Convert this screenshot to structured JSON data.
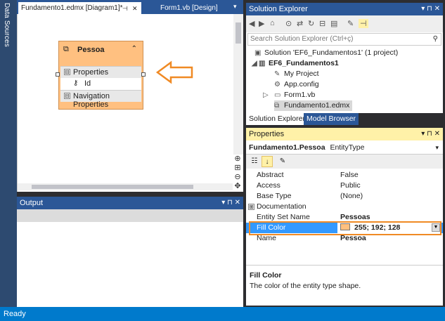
{
  "left_dock": {
    "label": "Data Sources"
  },
  "doc_tabs": [
    {
      "label": "Fundamento1.edmx [Diagram1]*",
      "active": true,
      "pin_icon": "pin-icon",
      "close_icon": "close-icon"
    },
    {
      "label": "Form1.vb [Design]",
      "active": false
    }
  ],
  "entity": {
    "icon": "entity-icon",
    "name": "Pessoa",
    "collapse_icon": "chevron-up-icon",
    "sections": [
      {
        "label": "Properties",
        "expander": "⊟"
      },
      {
        "label": "Navigation Properties",
        "expander": "⊟"
      }
    ],
    "properties": [
      {
        "icon": "key-icon",
        "label": "Id"
      }
    ],
    "fill_color": "#ffc080"
  },
  "annotation_arrow": {
    "icon": "arrow-left-icon",
    "color": "#f08a24"
  },
  "output_panel": {
    "title": "Output",
    "controls": "▾ ⊓ ✕"
  },
  "solution_explorer": {
    "title": "Solution Explorer",
    "controls": "▾ ⊓ ✕",
    "search_placeholder": "Search Solution Explorer (Ctrl+ç)",
    "tree": [
      {
        "label": "Solution 'EF6_Fundamentos1' (1 project)",
        "icon": "solution-icon",
        "level": 0,
        "bold": false
      },
      {
        "label": "EF6_Fundamentos1",
        "icon": "vb-project-icon",
        "level": 1,
        "bold": true,
        "expander": "◢"
      },
      {
        "label": "My Project",
        "icon": "wrench-icon",
        "level": 2
      },
      {
        "label": "App.config",
        "icon": "config-icon",
        "level": 2
      },
      {
        "label": "Form1.vb",
        "icon": "form-icon",
        "level": 2,
        "expander": "▷"
      },
      {
        "label": "Fundamento1.edmx",
        "icon": "edmx-icon",
        "level": 2,
        "selected": true
      }
    ],
    "bottom_tabs": [
      {
        "label": "Solution Explorer",
        "active": true
      },
      {
        "label": "Model Browser",
        "active": false
      }
    ]
  },
  "properties": {
    "title": "Properties",
    "controls": "▾ ⊓ ✕",
    "object_name": "Fundamento1.Pessoa",
    "object_type": "EntityType",
    "rows": [
      {
        "name": "Abstract",
        "value": "False"
      },
      {
        "name": "Access",
        "value": "Public"
      },
      {
        "name": "Base Type",
        "value": "(None)"
      },
      {
        "name": "Documentation",
        "value": "",
        "expander": "⊞"
      },
      {
        "name": "Entity Set Name",
        "value": "Pessoas",
        "bold": true
      },
      {
        "name": "Fill Color",
        "value": "255; 192; 128",
        "selected": true,
        "swatch": "#ffc080"
      },
      {
        "name": "Name",
        "value": "Pessoa",
        "bold": true
      }
    ],
    "description_title": "Fill Color",
    "description_text": "The color of the entity type shape."
  },
  "status": {
    "text": "Ready"
  },
  "colors": {
    "accent": "#007acc",
    "title_bar": "#2b5797",
    "highlight": "#f08a24",
    "entity_fill": "#ffc080"
  }
}
